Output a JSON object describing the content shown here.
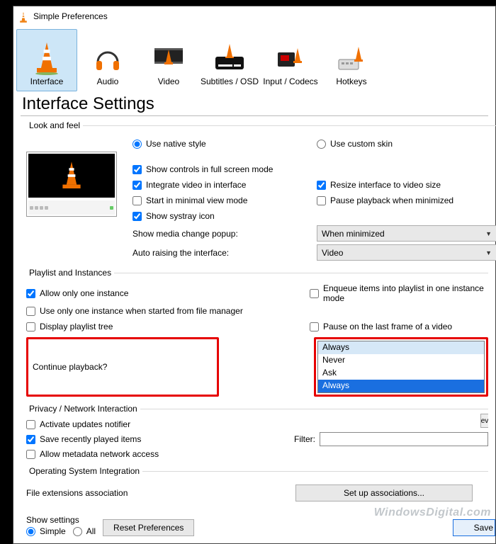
{
  "window": {
    "title": "Simple Preferences"
  },
  "toolbar": {
    "items": [
      {
        "label": "Interface"
      },
      {
        "label": "Audio"
      },
      {
        "label": "Video"
      },
      {
        "label": "Subtitles / OSD"
      },
      {
        "label": "Input / Codecs"
      },
      {
        "label": "Hotkeys"
      }
    ]
  },
  "page": {
    "title": "Interface Settings"
  },
  "look": {
    "legend": "Look and feel",
    "native": "Use native style",
    "custom": "Use custom skin",
    "show_controls": "Show controls in full screen mode",
    "integrate_video": "Integrate video in interface",
    "resize": "Resize interface to video size",
    "start_minimal": "Start in minimal view mode",
    "pause_minimized": "Pause playback when minimized",
    "systray": "Show systray icon",
    "show_popup_lbl": "Show media change popup:",
    "show_popup_val": "When minimized",
    "auto_raise_lbl": "Auto raising the interface:",
    "auto_raise_val": "Video"
  },
  "playlist": {
    "legend": "Playlist and Instances",
    "one_instance": "Allow only one instance",
    "enqueue": "Enqueue items into playlist in one instance mode",
    "one_fm": "Use only one instance when started from file manager",
    "display_tree": "Display playlist tree",
    "pause_last": "Pause on the last frame of a video",
    "continue_lbl": "Continue playback?",
    "options": [
      "Always",
      "Never",
      "Ask",
      "Always"
    ]
  },
  "privacy": {
    "legend": "Privacy / Network Interaction",
    "updates": "Activate updates notifier",
    "save_recent": "Save recently played items",
    "filter_lbl": "Filter:",
    "filter_val": "",
    "metadata": "Allow metadata network access"
  },
  "os": {
    "legend": "Operating System Integration",
    "file_ext": "File extensions association",
    "setup_btn": "Set up associations..."
  },
  "footer": {
    "show_settings": "Show settings",
    "simple": "Simple",
    "all": "All",
    "reset": "Reset Preferences",
    "save": "Save"
  },
  "watermark": "WindowsDigital.com"
}
